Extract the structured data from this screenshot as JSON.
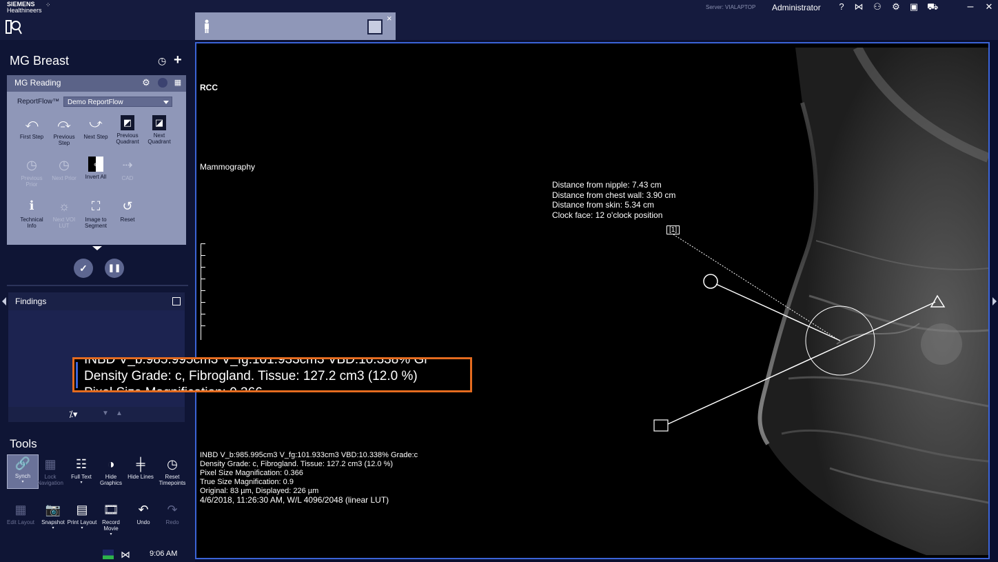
{
  "header": {
    "brand_line1": "SIEMENS",
    "brand_line2": "Healthineers",
    "server": "Server: VIALAPTOP",
    "user": "Administrator",
    "icons": [
      "help-icon",
      "bowtie-icon",
      "users-icon",
      "gear-icon",
      "toolbox-icon",
      "cart-icon"
    ],
    "window_controls": [
      "minimize",
      "close"
    ]
  },
  "tab": {
    "close": "×"
  },
  "workflow": {
    "title": "MG Breast",
    "panel_title": "MG Reading",
    "reportflow_label": "ReportFlow™",
    "reportflow_value": "Demo ReportFlow",
    "tools": [
      {
        "label": "First Step",
        "icon": "first-step-icon",
        "enabled": true
      },
      {
        "label": "Previous Step",
        "icon": "previous-step-icon",
        "enabled": true
      },
      {
        "label": "Next Step",
        "icon": "next-step-icon",
        "enabled": true
      },
      {
        "label": "Previous Quadrant",
        "icon": "previous-quadrant-icon",
        "enabled": true
      },
      {
        "label": "Next Quadrant",
        "icon": "next-quadrant-icon",
        "enabled": true
      },
      {
        "label": "Previous Prior",
        "icon": "previous-prior-icon",
        "enabled": false
      },
      {
        "label": "Next Prior",
        "icon": "next-prior-icon",
        "enabled": false
      },
      {
        "label": "Invert All",
        "icon": "invert-all-icon",
        "enabled": true
      },
      {
        "label": "CAD",
        "icon": "cad-icon",
        "enabled": false
      },
      {
        "label": "Technical Info",
        "icon": "info-icon",
        "enabled": true
      },
      {
        "label": "Next VOI LUT",
        "icon": "voi-lut-icon",
        "enabled": false
      },
      {
        "label": "Image to Segment",
        "icon": "image-to-segment-icon",
        "enabled": true
      },
      {
        "label": "Reset",
        "icon": "reset-icon",
        "enabled": true
      }
    ]
  },
  "findings": {
    "title": "Findings"
  },
  "tools_section": {
    "title": "Tools",
    "row1": [
      {
        "label": "Synch",
        "icon": "link-icon",
        "enabled": true,
        "active": true
      },
      {
        "label": "Lock Navigation",
        "icon": "lock-navigation-icon",
        "enabled": false
      },
      {
        "label": "Full Text",
        "icon": "full-text-icon",
        "enabled": true
      },
      {
        "label": "Hide Graphics",
        "icon": "hide-graphics-icon",
        "enabled": true
      },
      {
        "label": "Hide Lines",
        "icon": "hide-lines-icon",
        "enabled": true
      },
      {
        "label": "Reset Timepoints",
        "icon": "reset-timepoints-icon",
        "enabled": true
      }
    ],
    "row2": [
      {
        "label": "Edit Layout",
        "icon": "edit-layout-icon",
        "enabled": false
      },
      {
        "label": "Snapshot",
        "icon": "camera-icon",
        "enabled": true
      },
      {
        "label": "Print Layout",
        "icon": "print-layout-icon",
        "enabled": true
      },
      {
        "label": "Record Movie",
        "icon": "record-movie-icon",
        "enabled": true
      },
      {
        "label": "Undo",
        "icon": "undo-icon",
        "enabled": true
      },
      {
        "label": "Redo",
        "icon": "redo-icon",
        "enabled": false
      }
    ]
  },
  "status": {
    "time": "9:06 AM"
  },
  "viewer": {
    "view_label": "RCC",
    "modality": "Mammography",
    "annotation": [
      "Distance from nipple: 7.43 cm",
      "Distance from chest wall: 3.90 cm",
      "Distance from skin: 5.34 cm",
      "Clock face: 12 o'clock position"
    ],
    "marker": "[1]",
    "info_lines": [
      "INBD V_b:985.995cm3 V_fg:101.933cm3 VBD:10.338% Grade:c",
      "Density Grade: c, Fibrogland. Tissue: 127.2 cm3 (12.0 %)",
      "Pixel Size Magnification: 0.366",
      "True Size Magnification: 0.9",
      "Original: 83 µm, Displayed: 226 µm",
      "4/6/2018, 11:26:30 AM, W/L 4096/2048 (linear LUT)"
    ],
    "zoom_lines": [
      "INBD V_b:985.995cm3 V_fg:101.933cm3 VBD:10.338% Gr",
      "Density Grade: c, Fibrogland. Tissue: 127.2 cm3 (12.0 %)",
      "Pixel Size Magnification: 0.366"
    ]
  },
  "colors": {
    "accent": "#3b64d8",
    "highlight": "#e46b1f",
    "panel": "#8f97b8"
  }
}
